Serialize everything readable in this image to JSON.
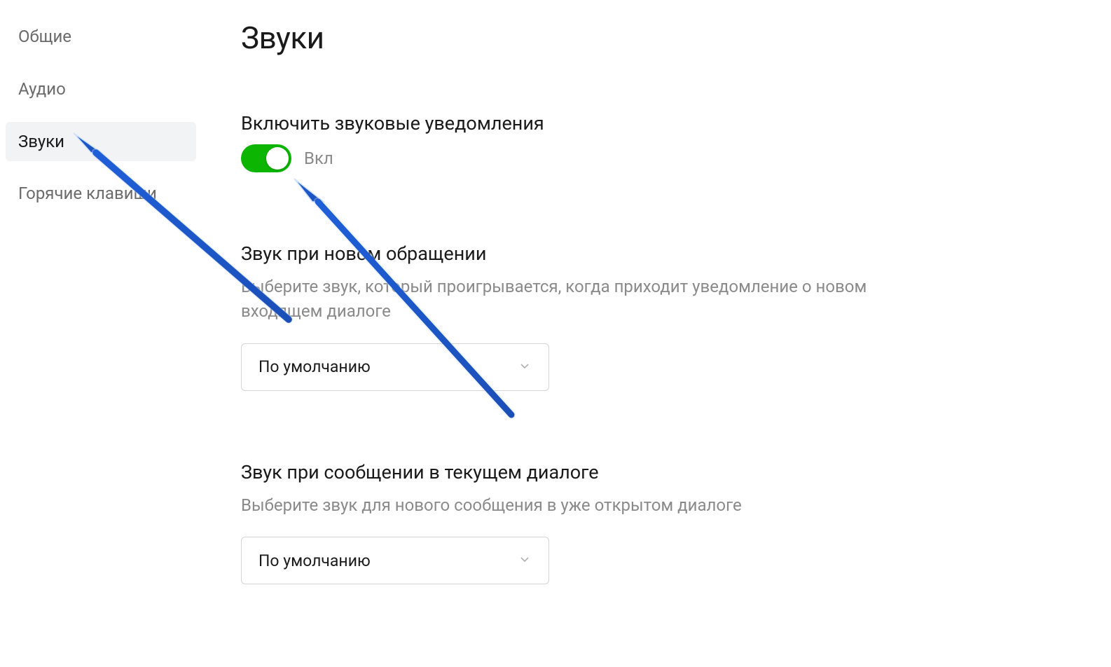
{
  "sidebar": {
    "items": [
      {
        "label": "Общие",
        "active": false
      },
      {
        "label": "Аудио",
        "active": false
      },
      {
        "label": "Звуки",
        "active": true
      },
      {
        "label": "Горячие клавиши",
        "active": false
      }
    ]
  },
  "page": {
    "title": "Звуки"
  },
  "sections": {
    "enable": {
      "title": "Включить звуковые уведомления",
      "toggle_state": "Вкл"
    },
    "new_request": {
      "title": "Звук при новом обращении",
      "desc": "Выберите звук, который проигрывается, когда приходит уведомление о новом входящем диалоге",
      "select_value": "По умолчанию"
    },
    "current_dialog": {
      "title": "Звук при сообщении в текущем диалоге",
      "desc": "Выберите звук для нового сообщения в уже открытом диалоге",
      "select_value": "По умолчанию"
    }
  }
}
